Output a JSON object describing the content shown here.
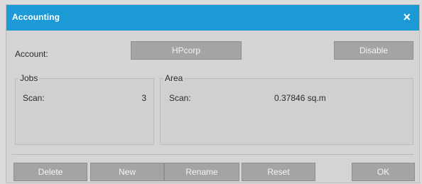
{
  "window": {
    "title": "Accounting",
    "close_symbol": "×"
  },
  "account": {
    "label": "Account:",
    "value": "HPcorp",
    "disable_label": "Disable"
  },
  "jobs": {
    "legend": "Jobs",
    "scan_label": "Scan:",
    "scan_value": "3"
  },
  "area": {
    "legend": "Area",
    "scan_label": "Scan:",
    "scan_value": "0.37846 sq.m"
  },
  "buttons": {
    "delete": "Delete",
    "new": "New",
    "rename": "Rename",
    "reset": "Reset",
    "ok": "OK"
  },
  "colors": {
    "titlebar": "#1b9ad6",
    "button": "#a4a4a4",
    "background": "#d4d4d4"
  },
  "icons": {
    "close": "close-icon"
  }
}
